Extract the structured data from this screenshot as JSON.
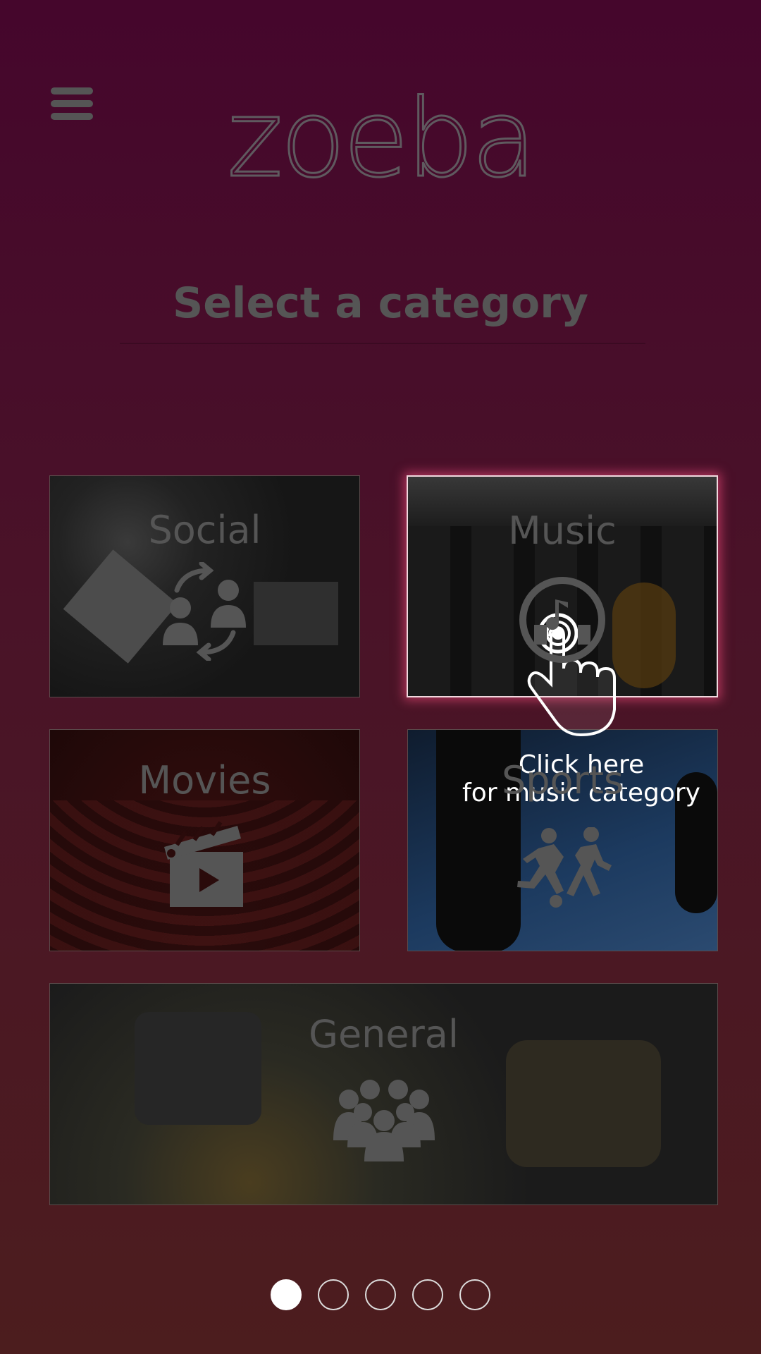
{
  "header": {
    "menu_icon": "hamburger-menu-icon",
    "logo_text": "zoeba"
  },
  "page": {
    "title": "Select a category"
  },
  "categories": [
    {
      "label": "Social",
      "icon": "social-exchange-icon"
    },
    {
      "label": "Music",
      "icon": "headphones-music-icon",
      "highlighted": true
    },
    {
      "label": "Movies",
      "icon": "clapperboard-icon"
    },
    {
      "label": "Sports",
      "icon": "sports-players-icon"
    },
    {
      "label": "General",
      "icon": "group-people-icon"
    }
  ],
  "hint": {
    "line1": "Click here",
    "line2": "for music category",
    "icon": "tap-hand-icon"
  },
  "pagination": {
    "total": 5,
    "active": 1
  },
  "colors": {
    "background_top": "#45062c",
    "background_bottom": "#4c1d1e",
    "highlight_glow": "#ff5082",
    "overlay_text": "#ffffff"
  }
}
